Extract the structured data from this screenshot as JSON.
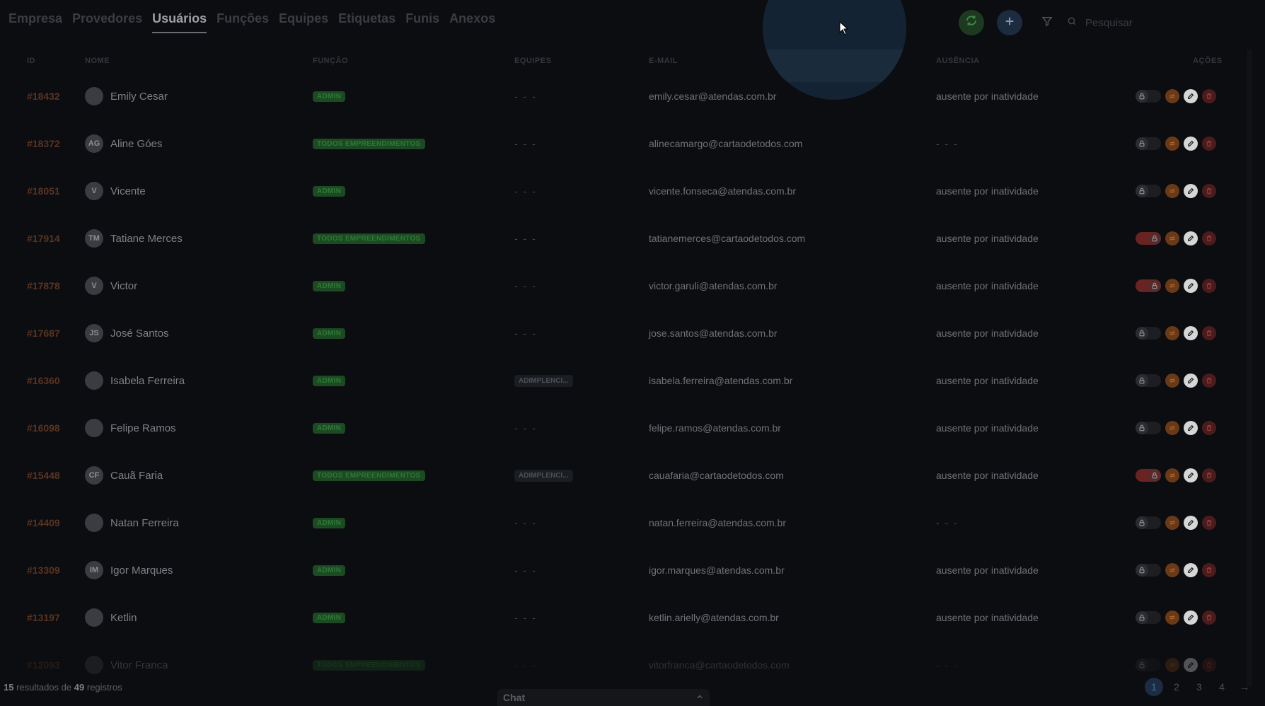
{
  "tabs": [
    "Empresa",
    "Provedores",
    "Usuários",
    "Funções",
    "Equipes",
    "Etiquetas",
    "Funis",
    "Anexos"
  ],
  "active_tab": "Usuários",
  "search": {
    "placeholder": "Pesquisar"
  },
  "columns": {
    "id": "ID",
    "name": "NOME",
    "role": "FUNÇÃO",
    "teams": "EQUIPES",
    "email": "E-MAIL",
    "absence": "AUSÊNCIA",
    "actions": "AÇÕES"
  },
  "rows": [
    {
      "id": "#18432",
      "initials": "",
      "name": "Emily Cesar",
      "role": "ADMIN",
      "team": "- - -",
      "email": "emily.cesar@atendas.com.br",
      "absence": "ausente por inatividade",
      "toggle": "off"
    },
    {
      "id": "#18372",
      "initials": "AG",
      "name": "Aline Góes",
      "role": "TODOS EMPREENDIMENTOS",
      "team": "- - -",
      "email": "alinecamargo@cartaodetodos.com",
      "absence": "- - -",
      "toggle": "off"
    },
    {
      "id": "#18051",
      "initials": "V",
      "name": "Vicente",
      "role": "ADMIN",
      "team": "- - -",
      "email": "vicente.fonseca@atendas.com.br",
      "absence": "ausente por inatividade",
      "toggle": "off"
    },
    {
      "id": "#17914",
      "initials": "TM",
      "name": "Tatiane Merces",
      "role": "TODOS EMPREENDIMENTOS",
      "team": "- - -",
      "email": "tatianemerces@cartaodetodos.com",
      "absence": "ausente por inatividade",
      "toggle": "on"
    },
    {
      "id": "#17878",
      "initials": "V",
      "name": "Victor",
      "role": "ADMIN",
      "team": "- - -",
      "email": "victor.garuli@atendas.com.br",
      "absence": "ausente por inatividade",
      "toggle": "on"
    },
    {
      "id": "#17687",
      "initials": "JS",
      "name": "José Santos",
      "role": "ADMIN",
      "team": "- - -",
      "email": "jose.santos@atendas.com.br",
      "absence": "ausente por inatividade",
      "toggle": "off"
    },
    {
      "id": "#16360",
      "initials": "",
      "name": "Isabela Ferreira",
      "role": "ADMIN",
      "team": "ADIMPLENCI...",
      "email": "isabela.ferreira@atendas.com.br",
      "absence": "ausente por inatividade",
      "toggle": "off"
    },
    {
      "id": "#16098",
      "initials": "",
      "name": "Felipe Ramos",
      "role": "ADMIN",
      "team": "- - -",
      "email": "felipe.ramos@atendas.com.br",
      "absence": "ausente por inatividade",
      "toggle": "off"
    },
    {
      "id": "#15448",
      "initials": "CF",
      "name": "Cauã Faria",
      "role": "TODOS EMPREENDIMENTOS",
      "team": "ADIMPLENCI...",
      "email": "cauafaria@cartaodetodos.com",
      "absence": "ausente por inatividade",
      "toggle": "on"
    },
    {
      "id": "#14409",
      "initials": "",
      "name": "Natan Ferreira",
      "role": "ADMIN",
      "team": "- - -",
      "email": "natan.ferreira@atendas.com.br",
      "absence": "- - -",
      "toggle": "off"
    },
    {
      "id": "#13309",
      "initials": "IM",
      "name": "Igor Marques",
      "role": "ADMIN",
      "team": "- - -",
      "email": "igor.marques@atendas.com.br",
      "absence": "ausente por inatividade",
      "toggle": "off"
    },
    {
      "id": "#13197",
      "initials": "",
      "name": "Ketlin",
      "role": "ADMIN",
      "team": "- - -",
      "email": "ketlin.arielly@atendas.com.br",
      "absence": "ausente por inatividade",
      "toggle": "off"
    },
    {
      "id": "#12093",
      "initials": "",
      "name": "Vitor Franca",
      "role": "TODOS EMPREENDIMENTOS",
      "team": "- - -",
      "email": "vitorfranca@cartaodetodos.com",
      "absence": "- - -",
      "toggle": "off"
    }
  ],
  "footer": {
    "results_count": "15",
    "results_middle": "resultados de",
    "total_count": "49",
    "results_suffix": "registros"
  },
  "chat": {
    "label": "Chat"
  },
  "pagination": {
    "pages": [
      "1",
      "2",
      "3",
      "4"
    ],
    "current": "1",
    "next_arrow": "→"
  },
  "icons": {
    "sync": "sync-icon",
    "add": "plus-icon",
    "filter": "filter-icon",
    "search": "search-icon",
    "lock": "lock-icon",
    "transfer": "transfer-icon",
    "edit": "edit-icon",
    "delete": "trash-icon"
  },
  "colors": {
    "background": "#0c0d10",
    "id_text": "#5a3321",
    "role_badge": "#1c4a22",
    "sync": "#1d3a21",
    "add": "#1c2b3e",
    "spotlight": "#142333"
  }
}
